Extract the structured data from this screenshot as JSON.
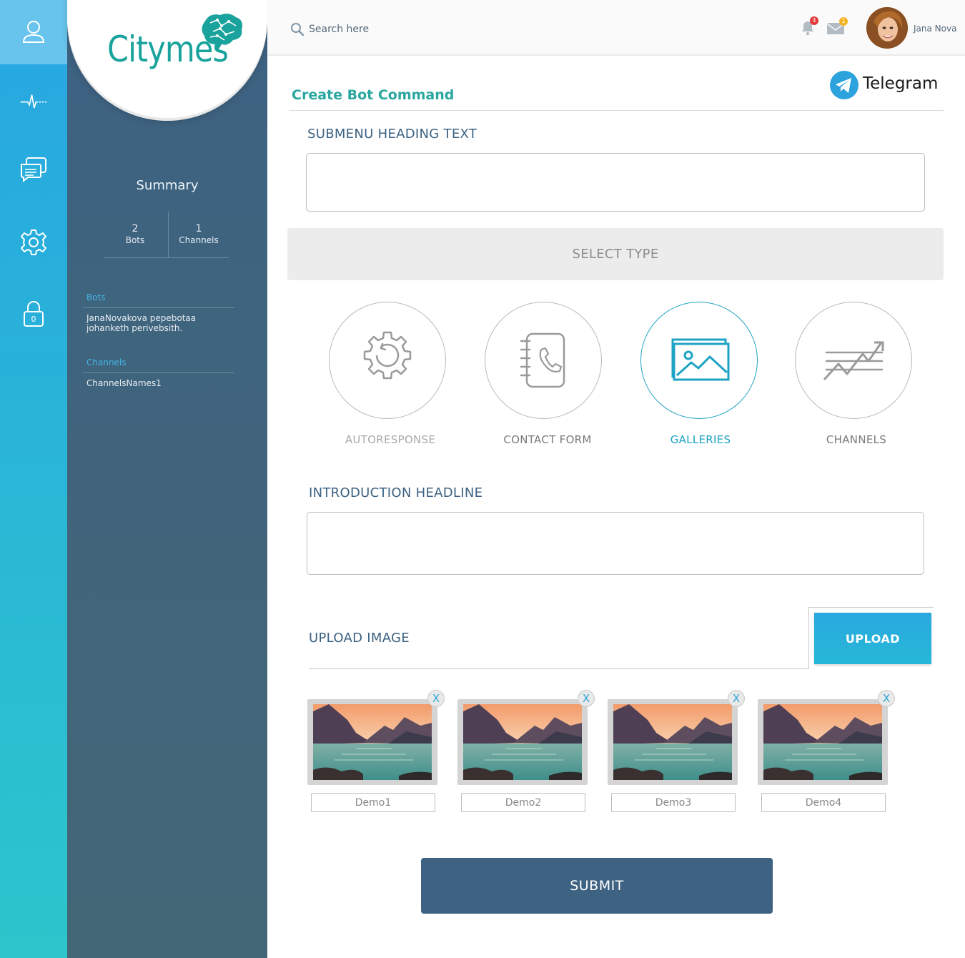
{
  "colors": {
    "accent_teal": "#2ba7a0",
    "accent_blue": "#1ea3c4",
    "sidebar_dark": "#3d6282",
    "rail_blue": "#27a6e1"
  },
  "rail": {
    "items": [
      {
        "name": "user-icon",
        "active": true
      },
      {
        "name": "activity-icon",
        "active": false
      },
      {
        "name": "chat-icon",
        "active": false
      },
      {
        "name": "settings-icon",
        "active": false
      },
      {
        "name": "lock-icon",
        "active": false,
        "count": "0"
      }
    ]
  },
  "sidebar": {
    "logo": "Citymes",
    "summary_title": "Summary",
    "stats": [
      {
        "value": "2",
        "label": "Bots"
      },
      {
        "value": "1",
        "label": "Channels"
      }
    ],
    "bots_label": "Bots",
    "bots_item": "JanaNovakova pepebotaa johanketh perivebsith.",
    "channels_label": "Channels",
    "channels_item": "ChannelsNames1"
  },
  "header": {
    "search_placeholder": "Search here",
    "notifications_count": "4",
    "messages_count": "1",
    "user_name": "Jana Nova"
  },
  "main": {
    "title": "Create Bot Command",
    "platform": "Telegram",
    "submenu_label": "SUBMENU HEADING TEXT",
    "submenu_value": "",
    "select_type_label": "SELECT TYPE",
    "types": [
      {
        "label": "AUTORESPONSE",
        "icon": "autoresponse-icon",
        "state": "muted"
      },
      {
        "label": "CONTACT FORM",
        "icon": "contact-form-icon",
        "state": "normal"
      },
      {
        "label": "GALLERIES",
        "icon": "gallery-icon",
        "state": "active"
      },
      {
        "label": "CHANNELS",
        "icon": "channels-chart-icon",
        "state": "normal"
      }
    ],
    "intro_label": "INTRODUCTION HEADLINE",
    "intro_value": "",
    "upload_label": "UPLOAD IMAGE",
    "upload_button": "UPLOAD",
    "images": [
      {
        "name": "Demo1",
        "close": "X"
      },
      {
        "name": "Demo2",
        "close": "X"
      },
      {
        "name": "Demo3",
        "close": "X"
      },
      {
        "name": "Demo4",
        "close": "X"
      }
    ],
    "submit_label": "SUBMIT"
  }
}
